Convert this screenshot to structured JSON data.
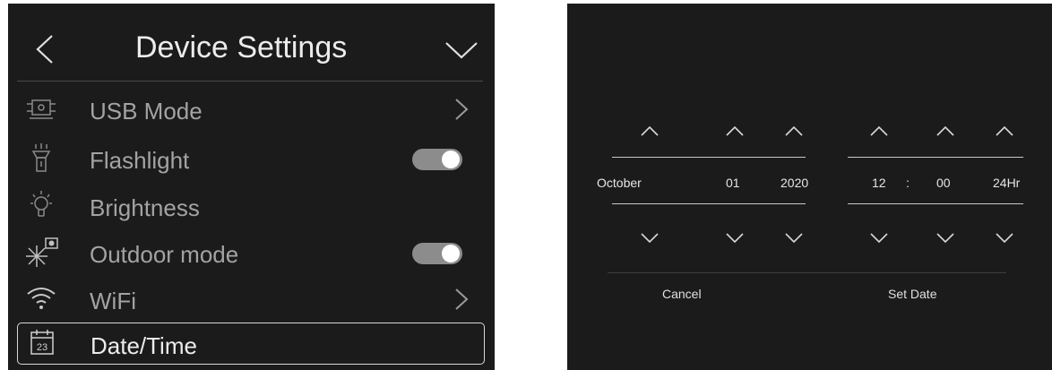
{
  "header": {
    "title": "Device Settings",
    "back_icon": "chevron-left-icon",
    "dropdown_icon": "chevron-down-icon"
  },
  "menu": [
    {
      "label": "USB Mode",
      "icon": "usb-mode-icon",
      "control": "chevron"
    },
    {
      "label": "Flashlight",
      "icon": "flashlight-icon",
      "control": "toggle",
      "on": true
    },
    {
      "label": "Brightness",
      "icon": "brightness-bulb-icon",
      "control": "none"
    },
    {
      "label": "Outdoor mode",
      "icon": "outdoor-mode-icon",
      "control": "toggle",
      "on": true
    },
    {
      "label": "WiFi",
      "icon": "wifi-icon",
      "control": "chevron"
    },
    {
      "label": "Date/Time",
      "icon": "calendar-icon",
      "icon_text": "23",
      "control": "none",
      "selected": true
    }
  ],
  "date_picker": {
    "month": "October",
    "day": "01",
    "year": "2020",
    "hour": "12",
    "time_separator": ":",
    "minute": "00",
    "format": "24Hr",
    "cancel_label": "Cancel",
    "set_label": "Set Date"
  },
  "colors": {
    "panel_bg": "#1b1b1b",
    "text_dim": "#a3a3a3",
    "text_bright": "#ececec",
    "toggle_on": "#8c8c8c"
  }
}
